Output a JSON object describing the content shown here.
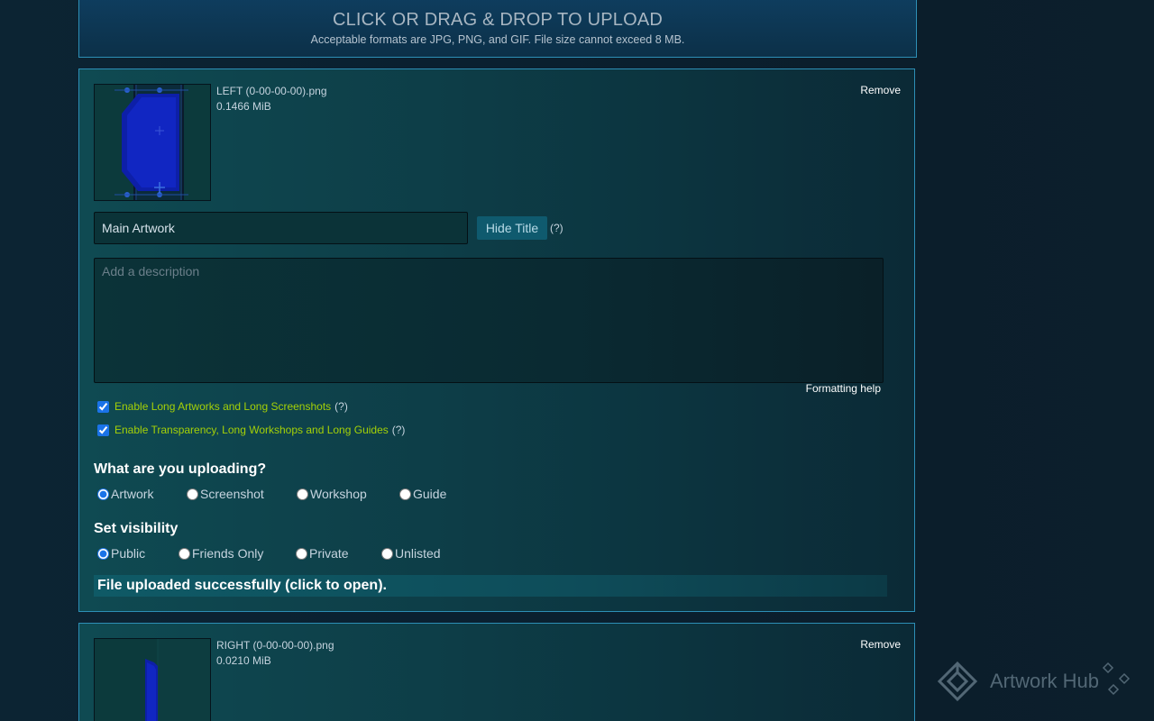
{
  "upload": {
    "title": "CLICK OR DRAG & DROP TO UPLOAD",
    "subtitle": "Acceptable formats are JPG, PNG, and GIF. File size cannot exceed 8 MB."
  },
  "items": [
    {
      "file_name": "LEFT (0-00-00-00).png",
      "file_size": "0.1466 MiB",
      "remove_label": "Remove",
      "title_value": "Main Artwork",
      "hide_title_label": "Hide Title",
      "help_mark": "(?)",
      "description_placeholder": "Add a description",
      "formatting_help": "Formatting help",
      "options": [
        {
          "label": "Enable Long Artworks and Long Screenshots",
          "checked": true,
          "help": "(?)"
        },
        {
          "label": "Enable Transparency, Long Workshops and Long Guides",
          "checked": true,
          "help": "(?)"
        }
      ],
      "upload_type_heading": "What are you uploading?",
      "upload_types": [
        "Artwork",
        "Screenshot",
        "Workshop",
        "Guide"
      ],
      "upload_type_selected": "Artwork",
      "visibility_heading": "Set visibility",
      "visibility_options": [
        "Public",
        "Friends Only",
        "Private",
        "Unlisted"
      ],
      "visibility_selected": "Public",
      "status": "File uploaded successfully (click to open)."
    },
    {
      "file_name": "RIGHT (0-00-00-00).png",
      "file_size": "0.0210 MiB",
      "remove_label": "Remove"
    }
  ],
  "watermark": {
    "text": "Artwork Hub"
  },
  "colors": {
    "border": "#2d8fb6",
    "accent_green": "#a4d007",
    "button_bg": "#0f5a6e"
  }
}
